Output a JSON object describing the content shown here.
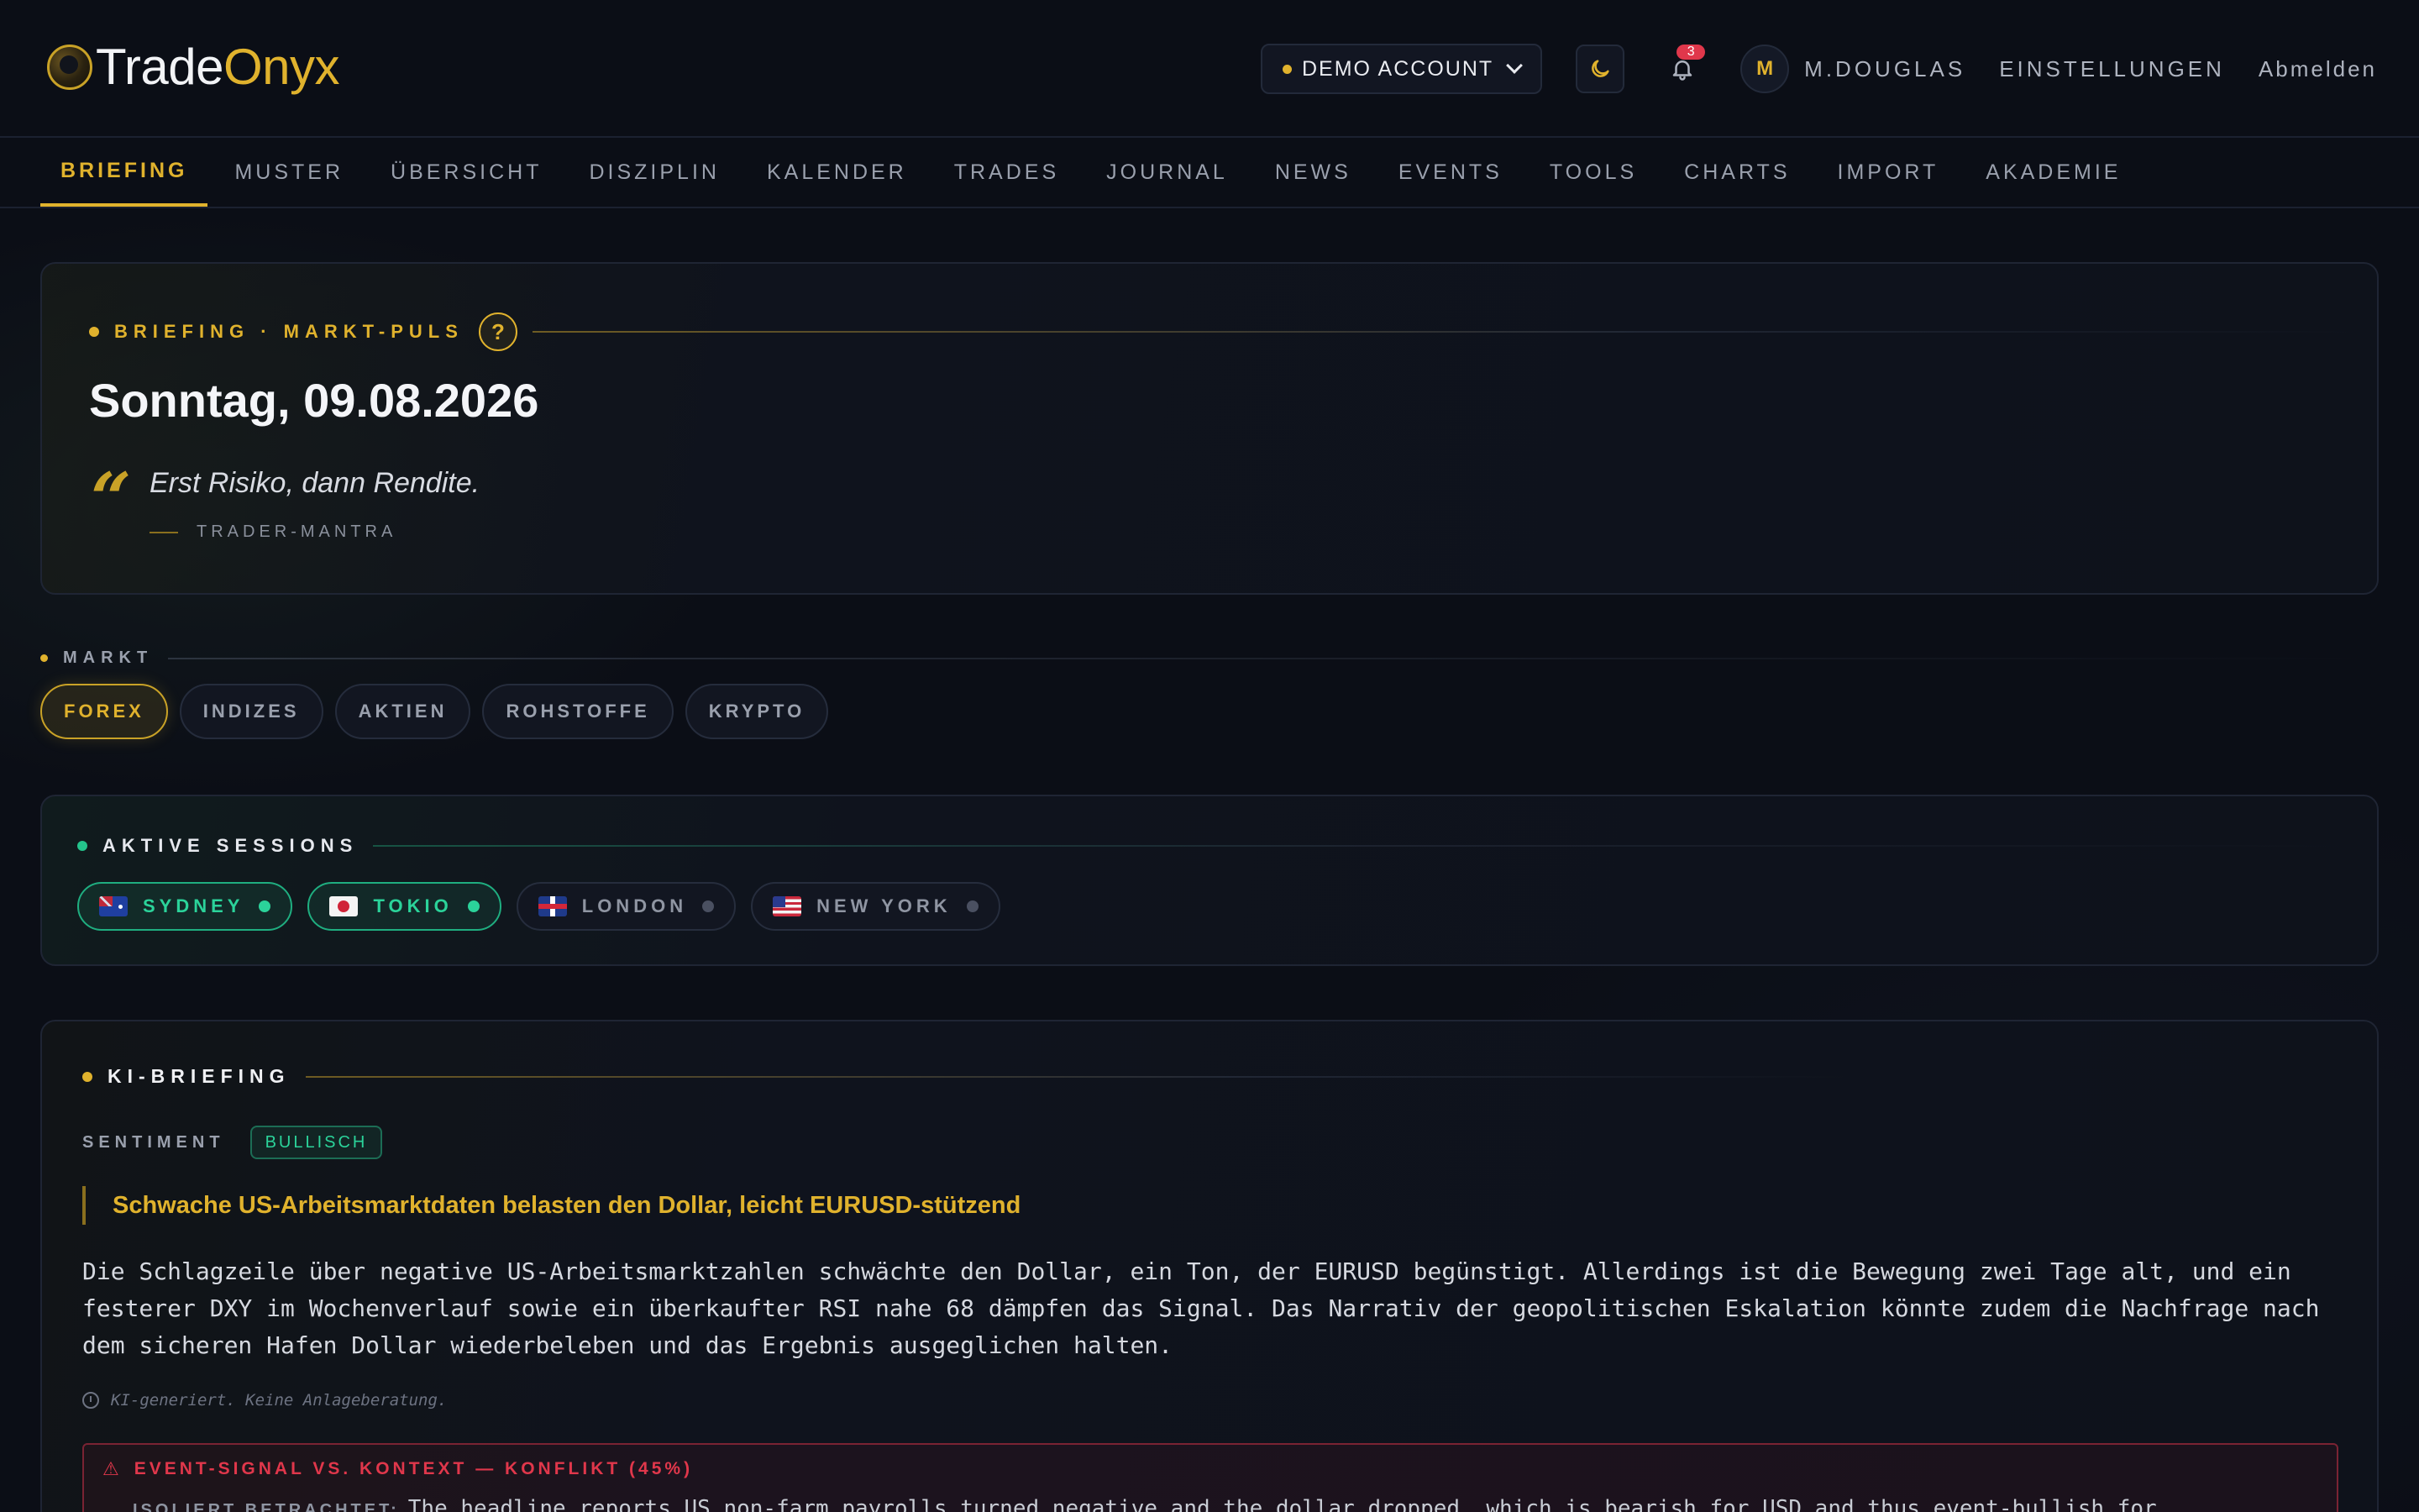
{
  "header": {
    "logo_part1": "Trade",
    "logo_part2": "Onyx",
    "account_label": "DEMO ACCOUNT",
    "notification_count": "3",
    "avatar_initial": "M",
    "username": "M.DOUGLAS",
    "settings_label": "EINSTELLUNGEN",
    "logout_label": "Abmelden"
  },
  "nav": {
    "items": [
      "BRIEFING",
      "MUSTER",
      "ÜBERSICHT",
      "DISZIPLIN",
      "KALENDER",
      "TRADES",
      "JOURNAL",
      "NEWS",
      "EVENTS",
      "TOOLS",
      "CHARTS",
      "IMPORT",
      "AKADEMIE"
    ],
    "active": "BRIEFING"
  },
  "briefing": {
    "section_label": "BRIEFING · MARKT-PULS",
    "help_label": "?",
    "date": "Sonntag, 09.08.2026",
    "quote_mark": "“",
    "quote": "Erst Risiko, dann Rendite.",
    "quote_source": "TRADER-MANTRA"
  },
  "market": {
    "label": "MARKT",
    "options": [
      "FOREX",
      "INDIZES",
      "AKTIEN",
      "ROHSTOFFE",
      "KRYPTO"
    ],
    "selected": "FOREX"
  },
  "sessions": {
    "label": "AKTIVE SESSIONS",
    "items": [
      {
        "name": "SYDNEY",
        "active": true,
        "flag": "au-flag"
      },
      {
        "name": "TOKIO",
        "active": true,
        "flag": "jp-flag"
      },
      {
        "name": "LONDON",
        "active": false,
        "flag": "uk-flag"
      },
      {
        "name": "NEW YORK",
        "active": false,
        "flag": "us-flag"
      }
    ]
  },
  "ki_briefing": {
    "label": "KI-BRIEFING",
    "sentiment_label": "SENTIMENT",
    "sentiment_value": "BULLISCH",
    "headline": "Schwache US-Arbeitsmarktdaten belasten den Dollar, leicht EURUSD-stützend",
    "body": "Die Schlagzeile über negative US-Arbeitsmarktzahlen schwächte den Dollar, ein Ton, der EURUSD begünstigt. Allerdings ist die Bewegung zwei Tage alt, und ein festerer DXY im Wochenverlauf sowie ein überkaufter RSI nahe 68 dämpfen das Signal. Das Narrativ der geopolitischen Eskalation könnte zudem die Nachfrage nach dem sicheren Hafen Dollar wiederbeleben und das Ergebnis ausgeglichen halten.",
    "disclaimer": "KI-generiert. Keine Anlageberatung.",
    "conflict_title": "EVENT-SIGNAL VS. KONTEXT — KONFLIKT (45%)",
    "conflict_key": "ISOLIERT BETRACHTET:",
    "conflict_text": "The headline reports US non-farm payrolls turned negative and the dollar dropped, which is bearish for USD and thus event-bullish for"
  },
  "colors": {
    "accent": "#e0b22d",
    "positive": "#2bd39a",
    "danger": "#e0374b",
    "background": "#0b0e16"
  }
}
